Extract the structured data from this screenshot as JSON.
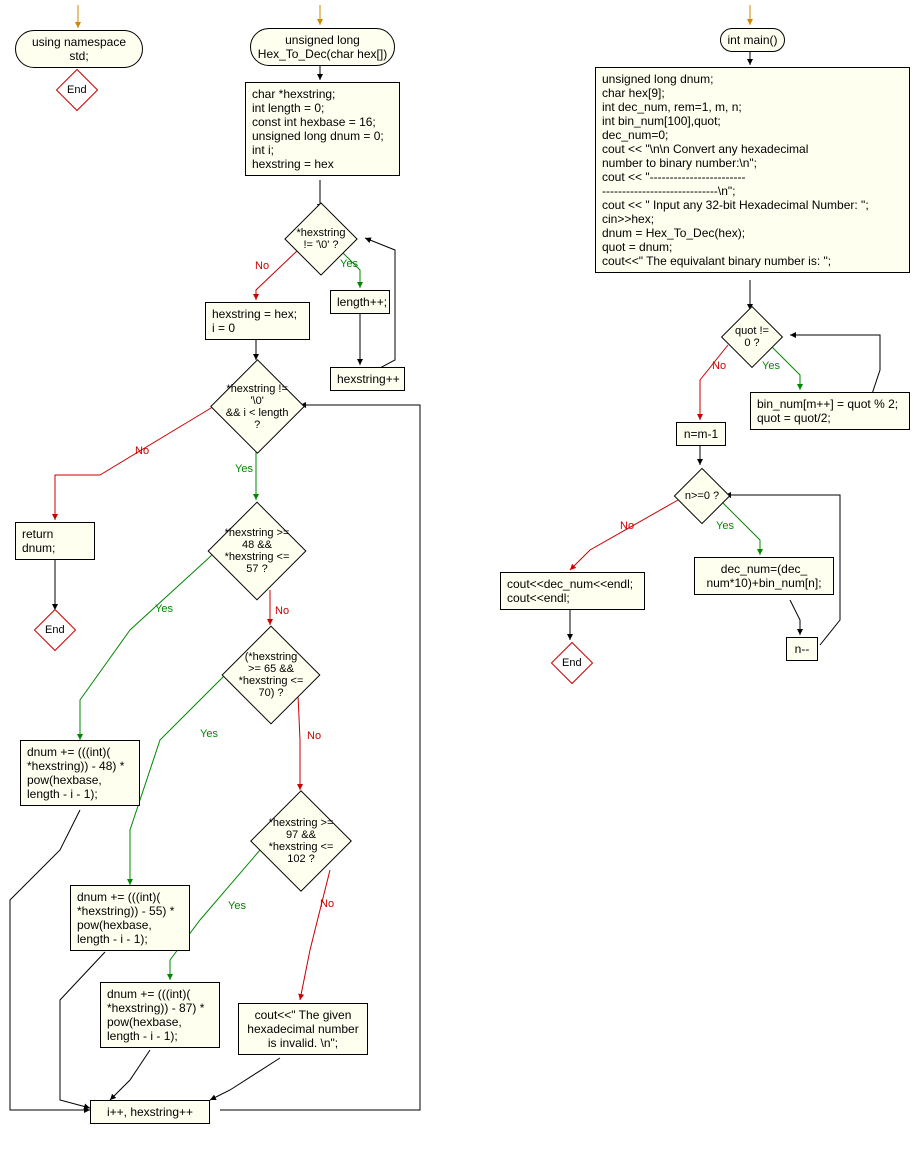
{
  "fc1": {
    "start": "using namespace std;",
    "end": "End"
  },
  "fc2": {
    "start": "unsigned long\nHex_To_Dec(char hex[])",
    "init": "char *hexstring;\nint length = 0;\nconst int hexbase = 16;\nunsigned long dnum = 0;\nint i;\nhexstring = hex",
    "cond1": "*hexstring != '\\0' ?",
    "lenpp": "length++;",
    "hexpp": "hexstring++",
    "reset": "hexstring = hex;\ni = 0",
    "cond2": "*hexstring != '\\0'\n&& i < length ?",
    "ret": "return dnum;",
    "end": "End",
    "cond3": "*hexstring >= 48 &&\n*hexstring <= 57 ?",
    "cond4": "(*hexstring >= 65 &&\n*hexstring <= 70) ?",
    "cond5": "*hexstring >= 97 &&\n*hexstring <= 102 ?",
    "calc1": "dnum += (((int)(\n*hexstring)) - 48) *\npow(hexbase,\nlength - i - 1);",
    "calc2": "dnum += (((int)(\n*hexstring)) - 55) *\npow(hexbase,\nlength - i - 1);",
    "calc3": "dnum += (((int)(\n*hexstring)) - 87) *\npow(hexbase,\nlength - i - 1);",
    "invalid": "cout<<\" The given\nhexadecimal number\nis invalid. \\n\";",
    "inc": "i++, hexstring++"
  },
  "fc3": {
    "start": "int main()",
    "init": "unsigned long dnum;\nchar hex[9];\nint dec_num, rem=1, m, n;\nint bin_num[100],quot;\ndec_num=0;\ncout << \"\\n\\n Convert any hexadecimal\nnumber to binary number:\\n\";\ncout << \"------------------------\n-----------------------------\\n\";\ncout << \" Input any 32-bit Hexadecimal Number: \";\ncin>>hex;\ndnum = Hex_To_Dec(hex);\nquot = dnum;\ncout<<\" The equivalant binary number is: \";",
    "cond1": "quot != 0 ?",
    "bin": "bin_num[m++] = quot % 2;\nquot = quot/2;",
    "nset": "n=m-1",
    "cond2": "n>=0 ?",
    "out": "cout<<dec_num<<endl;\ncout<<endl;",
    "end": "End",
    "dec": "dec_num=(dec_\nnum*10)+bin_num[n];",
    "ndec": "n--"
  },
  "labels": {
    "yes": "Yes",
    "no": "No"
  }
}
